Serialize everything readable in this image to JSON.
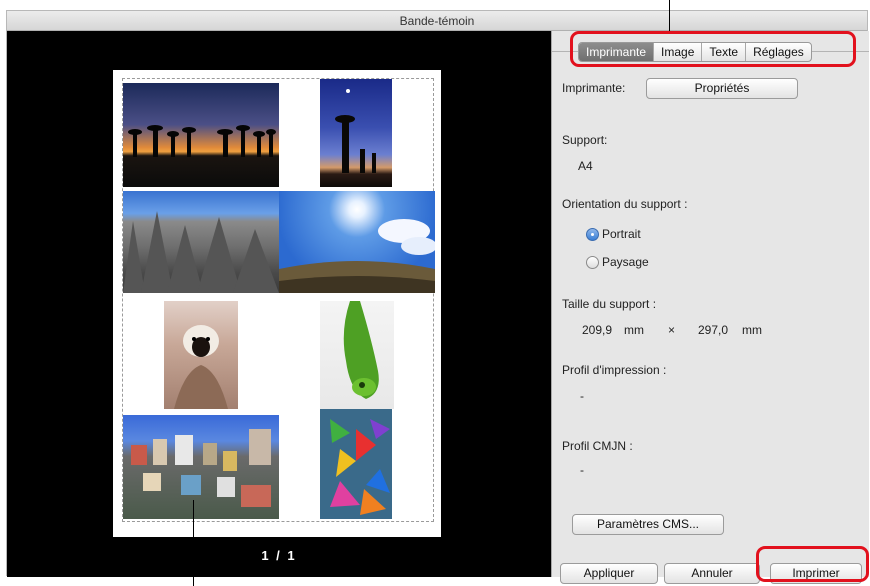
{
  "window": {
    "title": "Bande-témoin"
  },
  "preview": {
    "page_indicator": "1 / 1"
  },
  "tabs": [
    {
      "label": "Imprimante",
      "active": true
    },
    {
      "label": "Image",
      "active": false
    },
    {
      "label": "Texte",
      "active": false
    },
    {
      "label": "Réglages",
      "active": false
    }
  ],
  "printer": {
    "label": "Imprimante:",
    "properties_button": "Propriétés"
  },
  "support": {
    "label": "Support:",
    "value": "A4"
  },
  "orientation": {
    "label": "Orientation du support :",
    "options": [
      {
        "label": "Portrait",
        "selected": true
      },
      {
        "label": "Paysage",
        "selected": false
      }
    ]
  },
  "size": {
    "label": "Taille du support :",
    "width": "209,9",
    "height": "297,0",
    "unit": "mm",
    "times": "×"
  },
  "print_profile": {
    "label": "Profil d'impression :",
    "value": "-"
  },
  "cmyk_profile": {
    "label": "Profil CMJN :",
    "value": "-"
  },
  "buttons": {
    "cms": "Paramètres CMS...",
    "apply": "Appliquer",
    "cancel": "Annuler",
    "print": "Imprimer"
  },
  "thumbnails": [
    "baobab-sunset-photo",
    "baobab-night-photo",
    "rock-formation-photo",
    "sky-sun-photo",
    "lemur-photo",
    "chameleon-photo",
    "hillside-town-photo",
    "colorful-pinwheels-photo"
  ],
  "colors": {
    "highlight": "#e2111d",
    "active_tab": "#7d7d7d"
  }
}
